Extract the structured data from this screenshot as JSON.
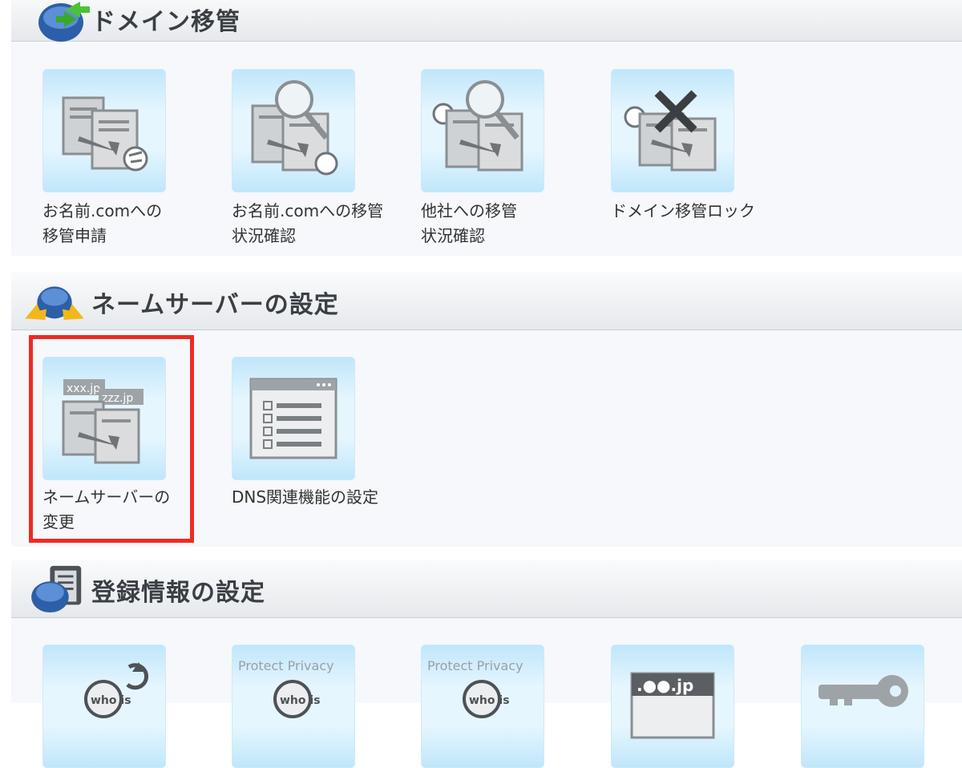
{
  "colors": {
    "highlight": "#ee2a24",
    "header_text": "#3a3f44",
    "tile_bg": "#d9f1fd"
  },
  "sections": {
    "transfer": {
      "title": "ドメイン移管",
      "icon": "globe-arrows-icon",
      "tiles": [
        {
          "label": "お名前.comへの\n移管申請",
          "icon": "server-transfer-hand-icon"
        },
        {
          "label": "お名前.comへの移管\n状況確認",
          "icon": "server-transfer-search-icon"
        },
        {
          "label": "他社への移管\n状況確認",
          "icon": "server-outbound-search-icon"
        },
        {
          "label": "ドメイン移管ロック",
          "icon": "server-transfer-lock-icon"
        }
      ]
    },
    "nameserver": {
      "title": "ネームサーバーの設定",
      "icon": "globe-yellow-arrows-icon",
      "tiles": [
        {
          "label": "ネームサーバーの\n変更",
          "icon": "domain-server-change-icon",
          "xxx": "xxx.jp",
          "zzz": "zzz.jp",
          "highlighted": true
        },
        {
          "label": "DNS関連機能の設定",
          "icon": "dns-checklist-window-icon"
        }
      ]
    },
    "registration": {
      "title": "登録情報の設定",
      "icon": "globe-document-icon",
      "tiles": [
        {
          "icon": "whois-refresh-icon",
          "badge": "who is"
        },
        {
          "icon": "whois-protect-privacy-icon",
          "caption": "Protect Privacy",
          "badge": "who is"
        },
        {
          "icon": "whois-protect-privacy-icon",
          "caption": "Protect Privacy",
          "badge": "who is"
        },
        {
          "icon": "jp-domain-window-icon",
          "caption": ".●●.jp"
        },
        {
          "icon": "key-icon"
        }
      ]
    }
  }
}
